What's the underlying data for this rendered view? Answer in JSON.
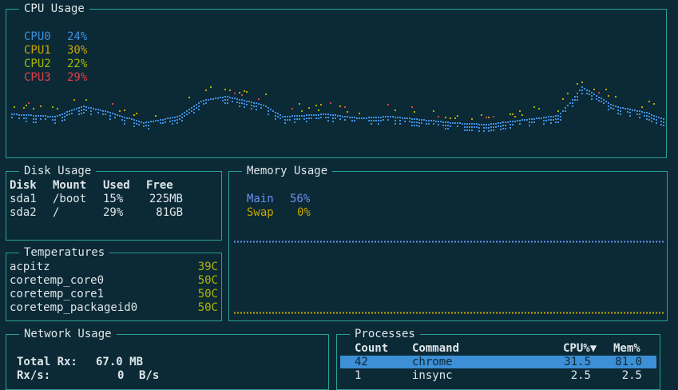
{
  "cpu": {
    "title": "CPU Usage",
    "cores": [
      {
        "name": "CPU0",
        "value": "24%",
        "color": "#3f8fe0"
      },
      {
        "name": "CPU1",
        "value": "30%",
        "color": "#c9a500"
      },
      {
        "name": "CPU2",
        "value": "22%",
        "color": "#a6b800"
      },
      {
        "name": "CPU3",
        "value": "29%",
        "color": "#e0404a"
      }
    ]
  },
  "disk": {
    "title": "Disk Usage",
    "headers": [
      "Disk",
      "Mount",
      "Used",
      "Free"
    ],
    "rows": [
      [
        "sda1",
        "/boot",
        "15%",
        "225MB"
      ],
      [
        "sda2",
        "/",
        "29%",
        "81GB"
      ]
    ]
  },
  "memory": {
    "title": "Memory Usage",
    "main_label": "Main",
    "main_value": "56%",
    "main_color": "#6f8ef0",
    "swap_label": "Swap",
    "swap_value": "0%",
    "swap_color": "#c9a500"
  },
  "temps": {
    "title": "Temperatures",
    "rows": [
      {
        "name": "acpitz",
        "value": "39C"
      },
      {
        "name": "coretemp_core0",
        "value": "50C"
      },
      {
        "name": "coretemp_core1",
        "value": "50C"
      },
      {
        "name": "coretemp_packageid0",
        "value": "50C"
      }
    ]
  },
  "network": {
    "title": "Network Usage",
    "total_rx_label": "Total Rx:",
    "total_rx_value": "67.0 MB",
    "rx_label": "Rx/s:",
    "rx_value": "0",
    "rx_unit": "B/s"
  },
  "processes": {
    "title": "Processes",
    "headers": {
      "count": "Count",
      "command": "Command",
      "cpu": "CPU%▼",
      "mem": "Mem%"
    },
    "rows": [
      {
        "count": "42",
        "command": "chrome",
        "cpu": "31.5",
        "mem": "81.0",
        "selected": true
      },
      {
        "count": "1",
        "command": "insync",
        "cpu": "2.5",
        "mem": "2.5",
        "selected": false
      }
    ],
    "selected_color": "#3d8fd6"
  }
}
